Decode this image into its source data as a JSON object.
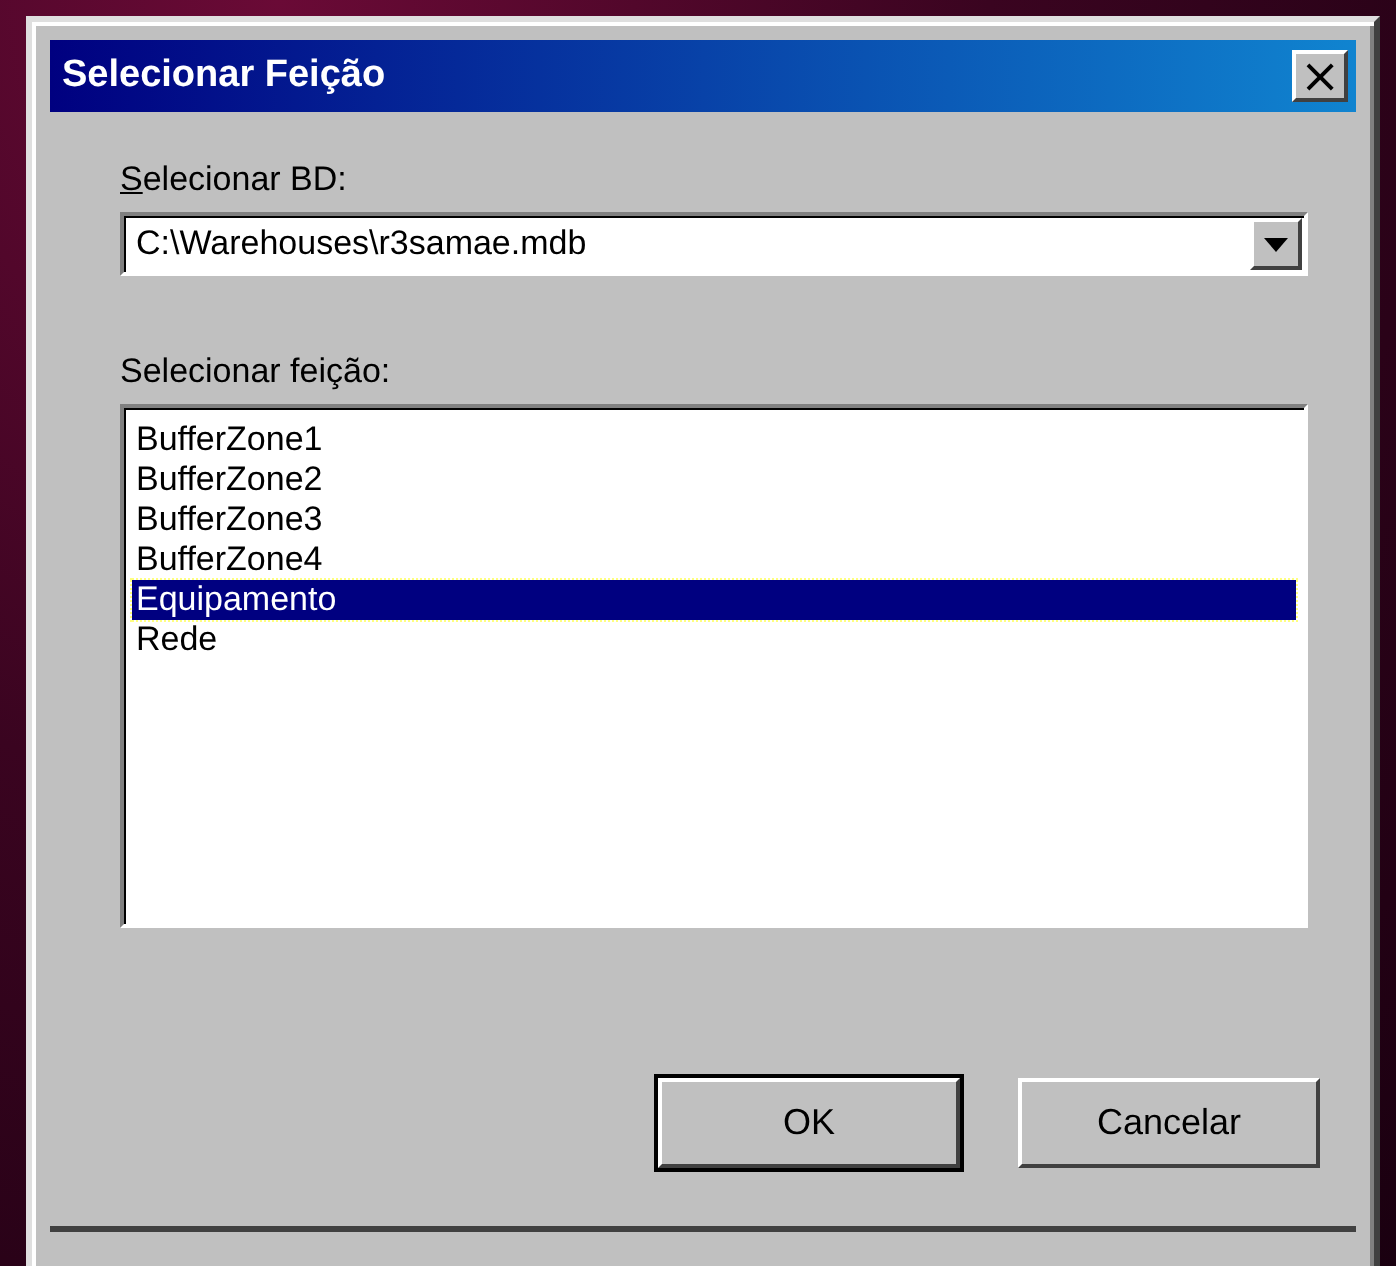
{
  "window": {
    "title": "Selecionar Feição",
    "close": "×"
  },
  "database": {
    "label": "Selecionar BD:",
    "value": "C:\\Warehouses\\r3samae.mdb"
  },
  "features": {
    "label": "Selecionar feição:",
    "items": [
      {
        "label": "BufferZone1",
        "selected": false
      },
      {
        "label": "BufferZone2",
        "selected": false
      },
      {
        "label": "BufferZone3",
        "selected": false
      },
      {
        "label": "BufferZone4",
        "selected": false
      },
      {
        "label": "Equipamento",
        "selected": true
      },
      {
        "label": "Rede",
        "selected": false
      }
    ]
  },
  "buttons": [
    {
      "label": "OK",
      "default": true
    },
    {
      "label": "Cancelar",
      "default": false
    }
  ]
}
